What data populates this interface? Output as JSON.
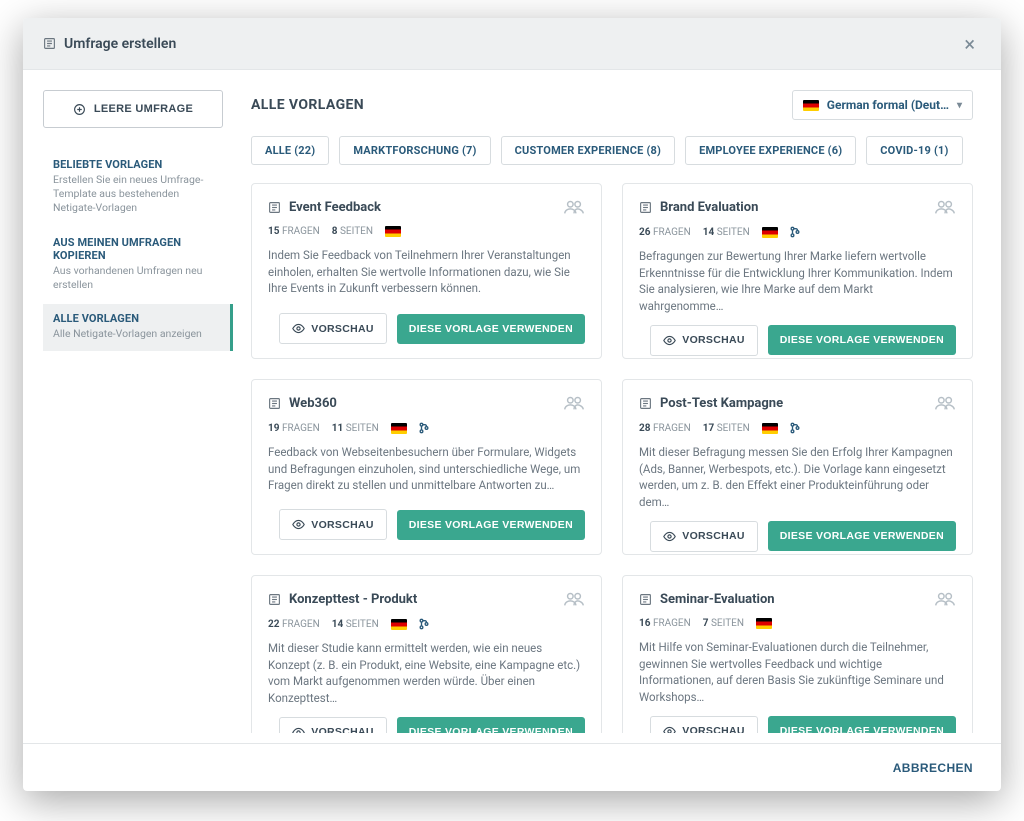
{
  "header": {
    "title": "Umfrage erstellen"
  },
  "sidebar": {
    "empty_label": "LEERE UMFRAGE",
    "items": [
      {
        "title": "BELIEBTE VORLAGEN",
        "desc": "Erstellen Sie ein neues Umfrage-Template aus bestehenden Netigate-Vorlagen"
      },
      {
        "title": "AUS MEINEN UMFRAGEN KOPIEREN",
        "desc": "Aus vorhandenen Umfragen neu erstellen"
      },
      {
        "title": "ALLE VORLAGEN",
        "desc": "Alle Netigate-Vorlagen anzeigen"
      }
    ]
  },
  "main": {
    "heading": "ALLE VORLAGEN",
    "language": "German formal (Deut…",
    "filters": [
      "ALLE (22)",
      "MARKTFORSCHUNG (7)",
      "CUSTOMER EXPERIENCE (8)",
      "EMPLOYEE EXPERIENCE (6)",
      "COVID-19 (1)"
    ],
    "preview_label": "VORSCHAU",
    "use_label": "DIESE VORLAGE VERWENDEN",
    "questions_label": "FRAGEN",
    "pages_label": "SEITEN",
    "cards": [
      {
        "title": "Event Feedback",
        "questions": "15",
        "pages": "8",
        "logic": false,
        "desc": "Indem Sie Feedback von Teilnehmern Ihrer Veranstaltungen einholen, erhalten Sie wertvolle Informationen dazu, wie Sie Ihre Events in Zukunft verbessern können."
      },
      {
        "title": "Brand Evaluation",
        "questions": "26",
        "pages": "14",
        "logic": true,
        "desc": "Befragungen zur Bewertung Ihrer Marke liefern wertvolle Erkenntnisse für die Entwicklung Ihrer Kommunikation. Indem Sie analysieren, wie Ihre Marke auf dem Markt wahrgenomme…"
      },
      {
        "title": "Web360",
        "questions": "19",
        "pages": "11",
        "logic": true,
        "desc": "Feedback von Webseitenbesuchern über Formulare, Widgets und Befragungen einzuholen, sind unterschiedliche Wege, um Fragen direkt zu stellen und unmittelbare Antworten zu…"
      },
      {
        "title": "Post-Test Kampagne",
        "questions": "28",
        "pages": "17",
        "logic": true,
        "desc": "Mit dieser Befragung messen Sie den Erfolg Ihrer Kampagnen (Ads, Banner, Werbespots, etc.). Die Vorlage kann eingesetzt werden, um z. B. den Effekt einer Produkteinführung oder dem…"
      },
      {
        "title": "Konzepttest - Produkt",
        "questions": "22",
        "pages": "14",
        "logic": true,
        "desc": "Mit dieser Studie kann ermittelt werden, wie ein neues Konzept (z. B. ein Produkt, eine Website, eine Kampagne etc.) vom Markt aufgenommen werden würde. Über einen Konzepttest…"
      },
      {
        "title": "Seminar-Evaluation",
        "questions": "16",
        "pages": "7",
        "logic": false,
        "desc": "Mit Hilfe von Seminar-Evaluationen durch die Teilnehmer, gewinnen Sie wertvolles Feedback und wichtige Informationen, auf deren Basis Sie zukünftige Seminare und Workshops…"
      }
    ]
  },
  "footer": {
    "cancel": "ABBRECHEN"
  }
}
